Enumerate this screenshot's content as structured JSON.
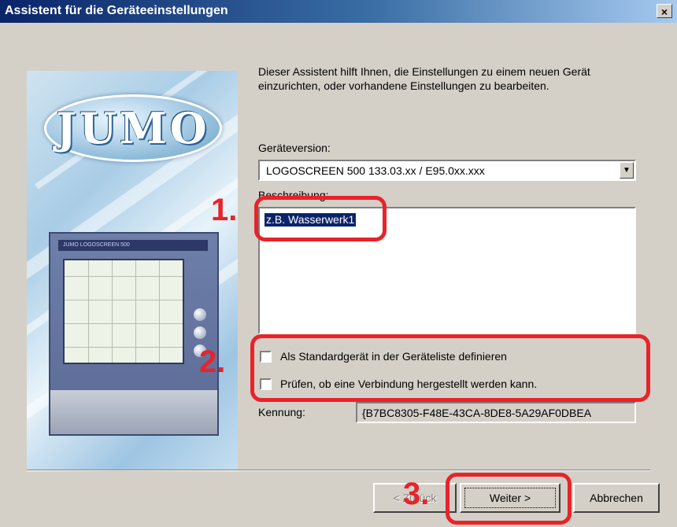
{
  "window": {
    "title": "Assistent für die Geräteeinstellungen",
    "close_glyph": "×"
  },
  "side_image": {
    "logo_text": "JUMO",
    "device_brand": "JUMO LOGOSCREEN 500"
  },
  "intro_text": "Dieser Assistent hilft Ihnen, die Einstellungen zu einem neuen Gerät einzurichten, oder vorhandene Einstellungen zu bearbeiten.",
  "device_version": {
    "label": "Geräteversion:",
    "value": "LOGOSCREEN 500 133.03.xx / E95.0xx.xxx",
    "arrow_glyph": "▼"
  },
  "description": {
    "label": "Beschreibung:",
    "value": "z.B. Wasserwerk1"
  },
  "checkboxes": [
    {
      "label": "Als Standardgerät in der Geräteliste definieren",
      "checked": false
    },
    {
      "label": "Prüfen, ob eine Verbindung hergestellt werden kann.",
      "checked": false
    }
  ],
  "identifier": {
    "label": "Kennung:",
    "value": "{B7BC8305-F48E-43CA-8DE8-5A29AF0DBEA"
  },
  "buttons": {
    "back": "< Zurück",
    "next": "Weiter >",
    "cancel": "Abbrechen"
  },
  "annotations": {
    "step1": "1.",
    "step2": "2.",
    "step3": "3.",
    "color": "#e8232a"
  },
  "colors": {
    "titlebar_start": "#0a246a",
    "dialog_bg": "#d4d0c8",
    "selection": "#0a246a"
  }
}
